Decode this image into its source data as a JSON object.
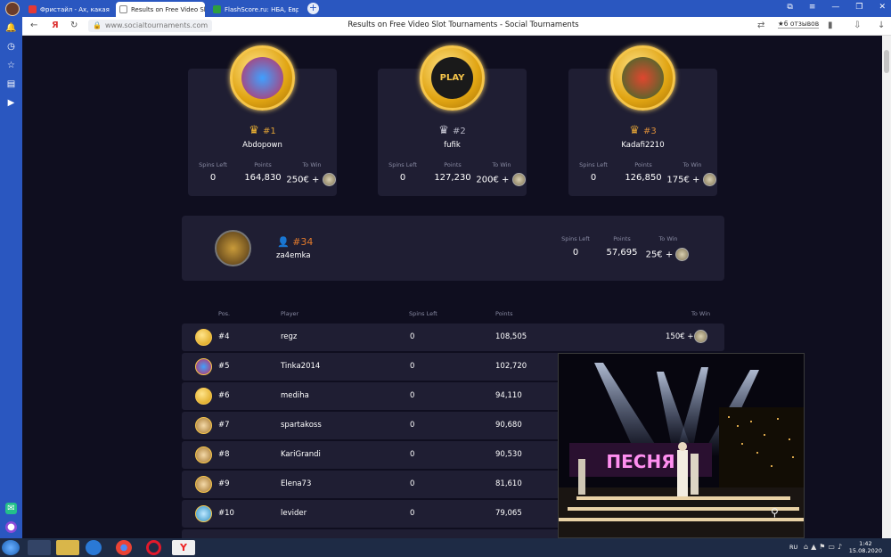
{
  "browser": {
    "tabs": [
      {
        "title": "Фристайл - Ах, какая",
        "icon_color": "#e53935"
      },
      {
        "title": "Results on Free Video Sl",
        "icon_color": "#ffffff"
      },
      {
        "title": "FlashScore.ru: НБА, Европ",
        "icon_color": "#2e9e3f"
      }
    ],
    "address": "www.socialtournaments.com",
    "page_title": "Results on Free Video Slot Tournaments - Social Tournaments",
    "reviews": "★6 отзывов"
  },
  "top3": [
    {
      "rank": "#1",
      "name": "Abdopown",
      "spins_left": "0",
      "points": "164,830",
      "to_win": "250€ +",
      "crown_color": "#f2b632",
      "coin_icon": "jester-icon"
    },
    {
      "rank": "#2",
      "name": "fufik",
      "spins_left": "0",
      "points": "127,230",
      "to_win": "200€ +",
      "crown_color": "#c9c9d6",
      "coin_icon": "play-icon"
    },
    {
      "rank": "#3",
      "name": "Kadafi2210",
      "spins_left": "0",
      "points": "126,850",
      "to_win": "175€ +",
      "crown_color": "#e0a236",
      "coin_icon": "parrot-icon"
    }
  ],
  "stat_labels": {
    "spins_left": "Spins Left",
    "points": "Points",
    "to_win": "To Win"
  },
  "me": {
    "rank": "#34",
    "name": "za4emka",
    "spins_left": "0",
    "points": "57,695",
    "to_win": "25€ +"
  },
  "table": {
    "headers": {
      "pos": "Pos.",
      "player": "Player",
      "spins_left": "Spins Left",
      "points": "Points",
      "to_win": "To Win"
    },
    "rows": [
      {
        "rank": "#4",
        "player": "regz",
        "spins_left": "0",
        "points": "108,505",
        "to_win": "150€ +"
      },
      {
        "rank": "#5",
        "player": "Tinka2014",
        "spins_left": "0",
        "points": "102,720",
        "to_win": ""
      },
      {
        "rank": "#6",
        "player": "mediha",
        "spins_left": "0",
        "points": "94,110",
        "to_win": ""
      },
      {
        "rank": "#7",
        "player": "spartakoss",
        "spins_left": "0",
        "points": "90,680",
        "to_win": ""
      },
      {
        "rank": "#8",
        "player": "KariGrandi",
        "spins_left": "0",
        "points": "90,530",
        "to_win": ""
      },
      {
        "rank": "#9",
        "player": "Elena73",
        "spins_left": "0",
        "points": "81,610",
        "to_win": ""
      },
      {
        "rank": "#10",
        "player": "levider",
        "spins_left": "0",
        "points": "79,065",
        "to_win": ""
      }
    ]
  },
  "video": {
    "sign_text": "ПЕСНЯ"
  },
  "taskbar": {
    "lang": "RU",
    "time": "1:42",
    "date": "15.08.2020"
  }
}
